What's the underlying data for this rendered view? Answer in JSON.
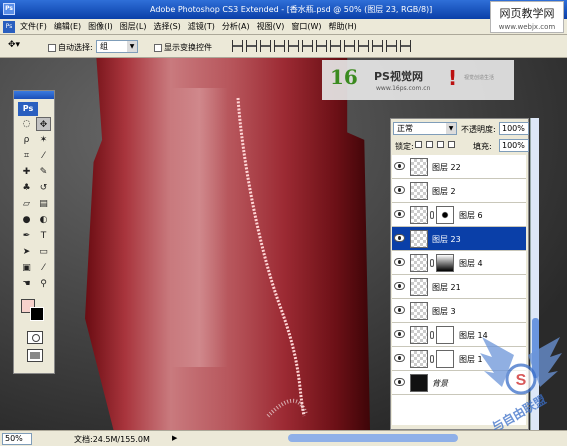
{
  "window": {
    "title": "Adobe Photoshop CS3 Extended - [香水瓶.psd @ 50% (图层 23, RGB/8)]",
    "app_icon": "Ps"
  },
  "brand_badge": {
    "line1": "网页教学网",
    "line2": "www.webjx.com"
  },
  "menubar": {
    "items": [
      "文件(F)",
      "编辑(E)",
      "图像(I)",
      "图层(L)",
      "选择(S)",
      "滤镜(T)",
      "分析(A)",
      "视图(V)",
      "窗口(W)",
      "帮助(H)"
    ]
  },
  "options_bar": {
    "auto_select_label": "自动选择:",
    "auto_select_value": "组",
    "transform_label": "显示变换控件"
  },
  "banner": {
    "logo": "16",
    "title": "PS视觉网",
    "url": "www.16ps.com.cn",
    "tagline": "视觉创造生活"
  },
  "toolbox": {
    "logo": "Ps"
  },
  "layers_panel": {
    "blend_mode": "正常",
    "opacity_label": "不透明度:",
    "opacity_value": "100%",
    "lock_label": "锁定:",
    "fill_label": "填充:",
    "fill_value": "100%",
    "layers": [
      {
        "name": "图层 22",
        "selected": false,
        "mask": "none"
      },
      {
        "name": "图层 2",
        "selected": false,
        "mask": "none"
      },
      {
        "name": "图层 6",
        "selected": false,
        "mask": "blob"
      },
      {
        "name": "图层 23",
        "selected": true,
        "mask": "none"
      },
      {
        "name": "图层 4",
        "selected": false,
        "mask": "gradient"
      },
      {
        "name": "图层 21",
        "selected": false,
        "mask": "none"
      },
      {
        "name": "图层 3",
        "selected": false,
        "mask": "none"
      },
      {
        "name": "图层 14",
        "selected": false,
        "mask": "white"
      },
      {
        "name": "图层 1",
        "selected": false,
        "mask": "white"
      },
      {
        "name": "背景",
        "selected": false,
        "mask": "none"
      }
    ]
  },
  "statusbar": {
    "zoom": "50%",
    "doc_info": "文档:24.5M/155.0M"
  },
  "watermark": {
    "text": "与自由联盟"
  }
}
